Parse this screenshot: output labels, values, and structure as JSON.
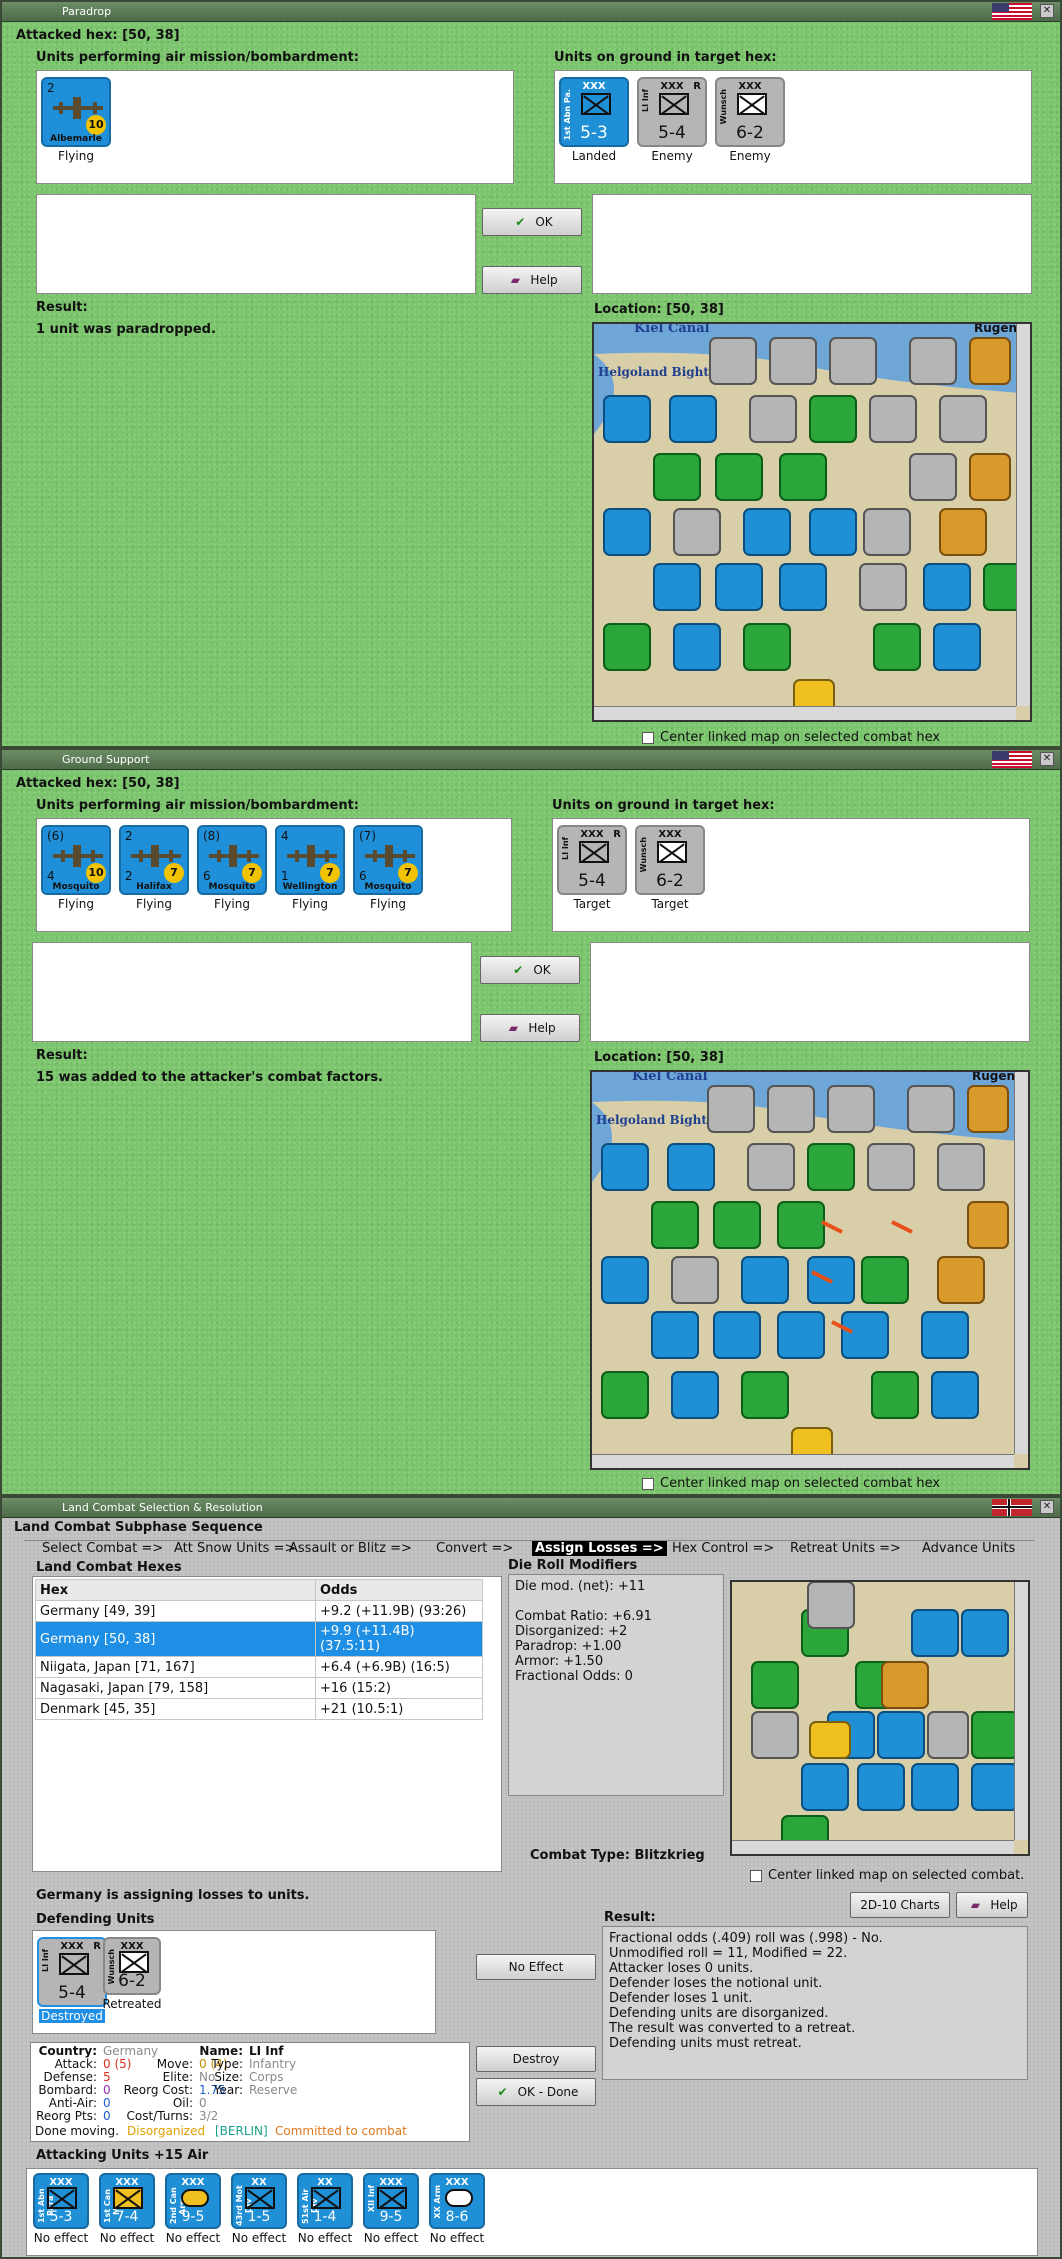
{
  "paradrop": {
    "title": "Paradrop",
    "attacked_hex": "Attacked hex:  [50, 38]",
    "air_label": "Units performing air mission/bombardment:",
    "ground_label": "Units on ground in target hex:",
    "air_units": [
      {
        "name": "Albemarle",
        "top_left": "2",
        "top_right": "",
        "badge": "10",
        "status": "Flying"
      }
    ],
    "ground_units": [
      {
        "side_text": "1st Abn Pa.",
        "size": "XXX",
        "factors": "5-3",
        "color": "blue",
        "flag": "",
        "status": "Landed"
      },
      {
        "side_text": "LI Inf",
        "size": "XXX",
        "factors": "5-4",
        "color": "grey",
        "flag": "R",
        "status": "Enemy"
      },
      {
        "side_text": "Wunsch",
        "size": "XXX",
        "factors": "6-2",
        "color": "grey",
        "flag": "",
        "status": "Enemy"
      }
    ],
    "ok_label": "OK",
    "help_label": "Help",
    "result_label": "Result:",
    "result_text": "1 unit was paradropped.",
    "location_label": "Location:  [50, 38]",
    "center_label": "Center linked map on selected combat hex"
  },
  "ground_support": {
    "title": "Ground Support",
    "attacked_hex": "Attacked hex:  [50, 38]",
    "air_label": "Units performing air mission/bombardment:",
    "ground_label": "Units on ground in target hex:",
    "air_units": [
      {
        "name": "Mosquito",
        "top_left": "(6)",
        "bottom_left": "4",
        "badge": "10",
        "status": "Flying"
      },
      {
        "name": "Halifax",
        "top_left": "2",
        "bottom_left": "2",
        "badge": "7",
        "status": "Flying"
      },
      {
        "name": "Mosquito",
        "top_left": "(8)",
        "bottom_left": "6",
        "badge": "7",
        "status": "Flying"
      },
      {
        "name": "Wellington",
        "top_left": "4",
        "bottom_left": "1",
        "badge": "7",
        "status": "Flying"
      },
      {
        "name": "Mosquito",
        "top_left": "(7)",
        "bottom_left": "6",
        "badge": "7",
        "status": "Flying"
      }
    ],
    "ground_units": [
      {
        "side_text": "LI Inf",
        "size": "XXX",
        "factors": "5-4",
        "flag": "R",
        "status": "Target"
      },
      {
        "side_text": "Wunsch",
        "size": "XXX",
        "factors": "6-2",
        "flag": "",
        "status": "Target"
      }
    ],
    "ok_label": "OK",
    "help_label": "Help",
    "result_label": "Result:",
    "result_text": "15 was added to the attacker's combat factors.",
    "location_label": "Location:  [50, 38]",
    "center_label": "Center linked map on selected combat hex"
  },
  "land_combat": {
    "title": "Land Combat Selection & Resolution",
    "subphase_label": "Land Combat Subphase Sequence",
    "sequence": [
      "Select Combat =>",
      "Att Snow Units =>",
      "Assault or Blitz =>",
      "Convert =>",
      "Assign Losses =>",
      "Hex Control =>",
      "Retreat Units =>",
      "Advance Units"
    ],
    "active_step": 4,
    "hexes_label": "Land Combat Hexes",
    "hex_header": "Hex",
    "odds_header": "Odds",
    "hexes": [
      {
        "hex": "Germany [49, 39]",
        "odds": "+9.2 (+11.9B) (93:26)"
      },
      {
        "hex": "Germany [50, 38]",
        "odds": "+9.9 (+11.4B) (37.5:11)"
      },
      {
        "hex": "Niigata, Japan [71, 167]",
        "odds": "+6.4 (+6.9B) (16:5)"
      },
      {
        "hex": "Nagasaki, Japan [79, 158]",
        "odds": "+16 (15:2)"
      },
      {
        "hex": "Denmark [45, 35]",
        "odds": "+21 (10.5:1)"
      }
    ],
    "selected_hex": 1,
    "die_roll_label": "Die Roll Modifiers",
    "die_roll_lines": [
      "Die mod. (net): +11",
      "",
      "Combat Ratio: +6.91",
      "Disorganized: +2",
      "Paradrop: +1.00",
      "Armor: +1.50",
      "Fractional Odds: 0"
    ],
    "combat_type": "Combat Type:  Blitzkrieg",
    "center_label": "Center linked map on selected combat.",
    "charts_label": "2D-10 Charts",
    "help_label": "Help",
    "assigning_text": "Germany is assigning losses to units.",
    "defending_label": "Defending Units",
    "defenders": [
      {
        "side_text": "LI Inf",
        "size": "XXX",
        "factors": "5-4",
        "flag": "R",
        "status": "Destroyed",
        "selected": true
      },
      {
        "side_text": "Wunsch",
        "size": "XXX",
        "factors": "6-2",
        "flag": "",
        "status": "Retreated",
        "selected": false
      }
    ],
    "no_effect_label": "No Effect",
    "destroy_label": "Destroy",
    "ok_done_label": "OK - Done",
    "result_label": "Result:",
    "result_lines": [
      "Fractional odds (.409) roll was (.998)  - No.",
      "Unmodified roll = 11, Modified = 22.",
      "Attacker loses 0 units.",
      "Defender loses the notional unit.",
      "Defender loses 1 unit.",
      "Defending units are disorganized.",
      "The result was converted to a retreat.",
      "Defending units must retreat."
    ],
    "unit_info": {
      "country_k": "Country:",
      "country_v": "Germany",
      "attack_k": "Attack:",
      "attack_v": "0 (5)",
      "defense_k": "Defense:",
      "defense_v": "5",
      "bombard_k": "Bombard:",
      "bombard_v": "0",
      "antiair_k": "Anti-Air:",
      "antiair_v": "0",
      "reorg_k": "Reorg Pts:",
      "reorg_v": "0",
      "name_k": "Name:",
      "name_v": "LI Inf",
      "move_k": "Move:",
      "move_v": "0 (4)",
      "elite_k": "Elite:",
      "elite_v": "No",
      "reorgcost_k": "Reorg Cost:",
      "reorgcost_v": "1.75",
      "oil_k": "Oil:",
      "oil_v": "0",
      "cost_k": "Cost/Turns:",
      "cost_v": "3/2",
      "type_k": "Type:",
      "type_v": "Infantry",
      "size_k": "Size:",
      "size_v": "Corps",
      "year_k": "Year:",
      "year_v": "Reserve",
      "status_1": "Done moving.",
      "status_2": "Disorganized",
      "status_3": "[BERLIN]",
      "status_4": "Committed to combat"
    },
    "attacking_label": "Attacking Units +15 Air",
    "attackers": [
      {
        "side_text": "1st Abn Para",
        "size": "XXX",
        "factors": "5-3",
        "status": "No effect",
        "color": "#1f8fd6"
      },
      {
        "side_text": "1st Can Mot",
        "size": "XXX",
        "factors": "7-4",
        "status": "No effect",
        "color": "#1f8fd6"
      },
      {
        "side_text": "2nd Can Arm",
        "size": "XXX",
        "factors": "9-5",
        "status": "No effect",
        "color": "#1f8fd6"
      },
      {
        "side_text": "43rd Mot Div",
        "size": "XX",
        "factors": "1-5",
        "status": "No effect",
        "color": "#1f8fd6"
      },
      {
        "side_text": "51st Air Div",
        "size": "XX",
        "factors": "1-4",
        "status": "No effect",
        "color": "#1f8fd6"
      },
      {
        "side_text": "XII Inf",
        "size": "XXX",
        "factors": "9-5",
        "status": "No effect",
        "color": "#1f8fd6"
      },
      {
        "side_text": "XX Arm",
        "size": "XXX",
        "factors": "8-6",
        "status": "No effect",
        "color": "#1f8fd6"
      }
    ]
  },
  "map_labels": {
    "kiel": "Kiel Canal",
    "bight": "Helgoland Bight",
    "rugen": "Rügen"
  },
  "colors": {
    "green_bg": "#7cc46e",
    "allied_blue": "#1f8fd6",
    "axis_grey": "#b5b5b5",
    "map_green": "#1c9c2e",
    "selection": "#1e8fe4"
  }
}
